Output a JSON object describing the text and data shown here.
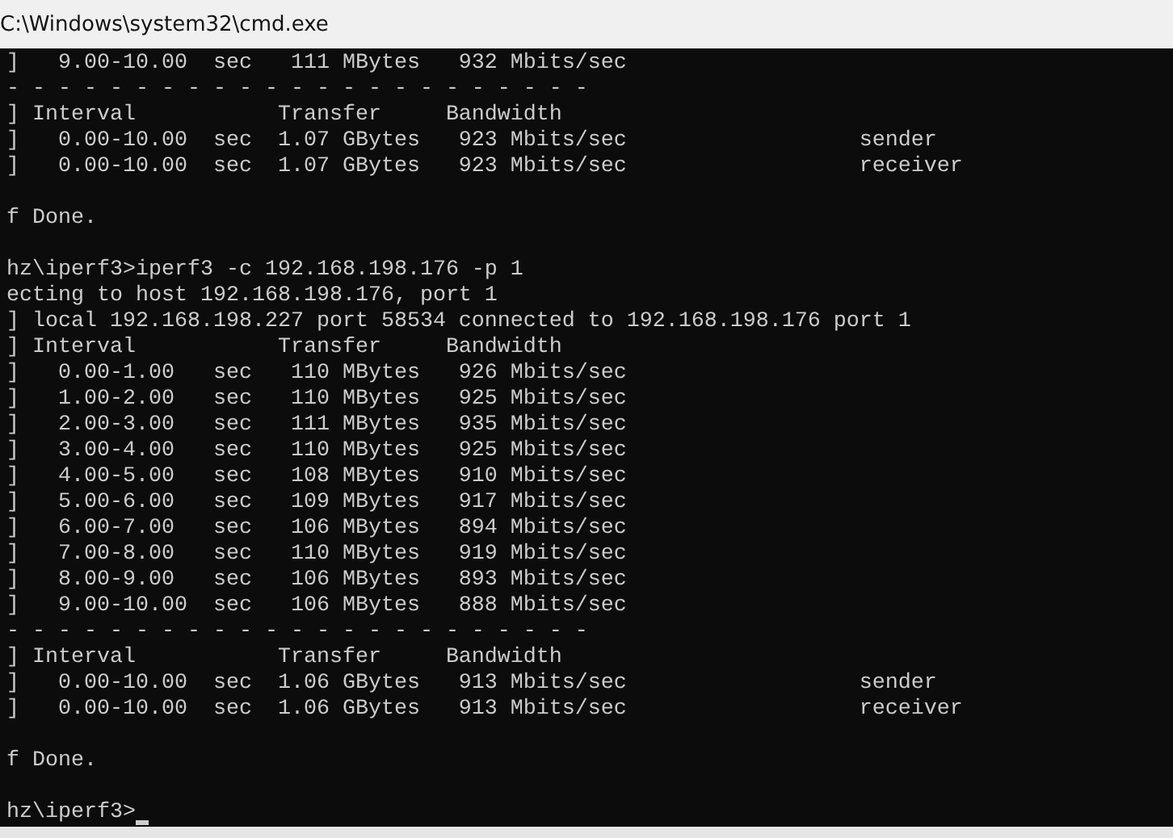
{
  "window": {
    "title": "C:\\Windows\\system32\\cmd.exe"
  },
  "terminal": {
    "blocks": [
      [
        "]   9.00-10.00  sec   111 MBytes   932 Mbits/sec",
        "- - - - - - - - - - - - - - - - - - - - - - -",
        "] Interval           Transfer     Bandwidth",
        "]   0.00-10.00  sec  1.07 GBytes   923 Mbits/sec                  sender",
        "]   0.00-10.00  sec  1.07 GBytes   923 Mbits/sec                  receiver"
      ],
      [
        "f Done."
      ],
      [
        "hz\\iperf3>iperf3 -c 192.168.198.176 -p 1",
        "ecting to host 192.168.198.176, port 1",
        "] local 192.168.198.227 port 58534 connected to 192.168.198.176 port 1",
        "] Interval           Transfer     Bandwidth",
        "]   0.00-1.00   sec   110 MBytes   926 Mbits/sec",
        "]   1.00-2.00   sec   110 MBytes   925 Mbits/sec",
        "]   2.00-3.00   sec   111 MBytes   935 Mbits/sec",
        "]   3.00-4.00   sec   110 MBytes   925 Mbits/sec",
        "]   4.00-5.00   sec   108 MBytes   910 Mbits/sec",
        "]   5.00-6.00   sec   109 MBytes   917 Mbits/sec",
        "]   6.00-7.00   sec   106 MBytes   894 Mbits/sec",
        "]   7.00-8.00   sec   110 MBytes   919 Mbits/sec",
        "]   8.00-9.00   sec   106 MBytes   893 Mbits/sec",
        "]   9.00-10.00  sec   106 MBytes   888 Mbits/sec",
        "- - - - - - - - - - - - - - - - - - - - - - -",
        "] Interval           Transfer     Bandwidth",
        "]   0.00-10.00  sec  1.06 GBytes   913 Mbits/sec                  sender",
        "]   0.00-10.00  sec  1.06 GBytes   913 Mbits/sec                  receiver"
      ],
      [
        "f Done."
      ]
    ],
    "prompt": {
      "text": "hz\\iperf3>",
      "cursor": true
    }
  }
}
